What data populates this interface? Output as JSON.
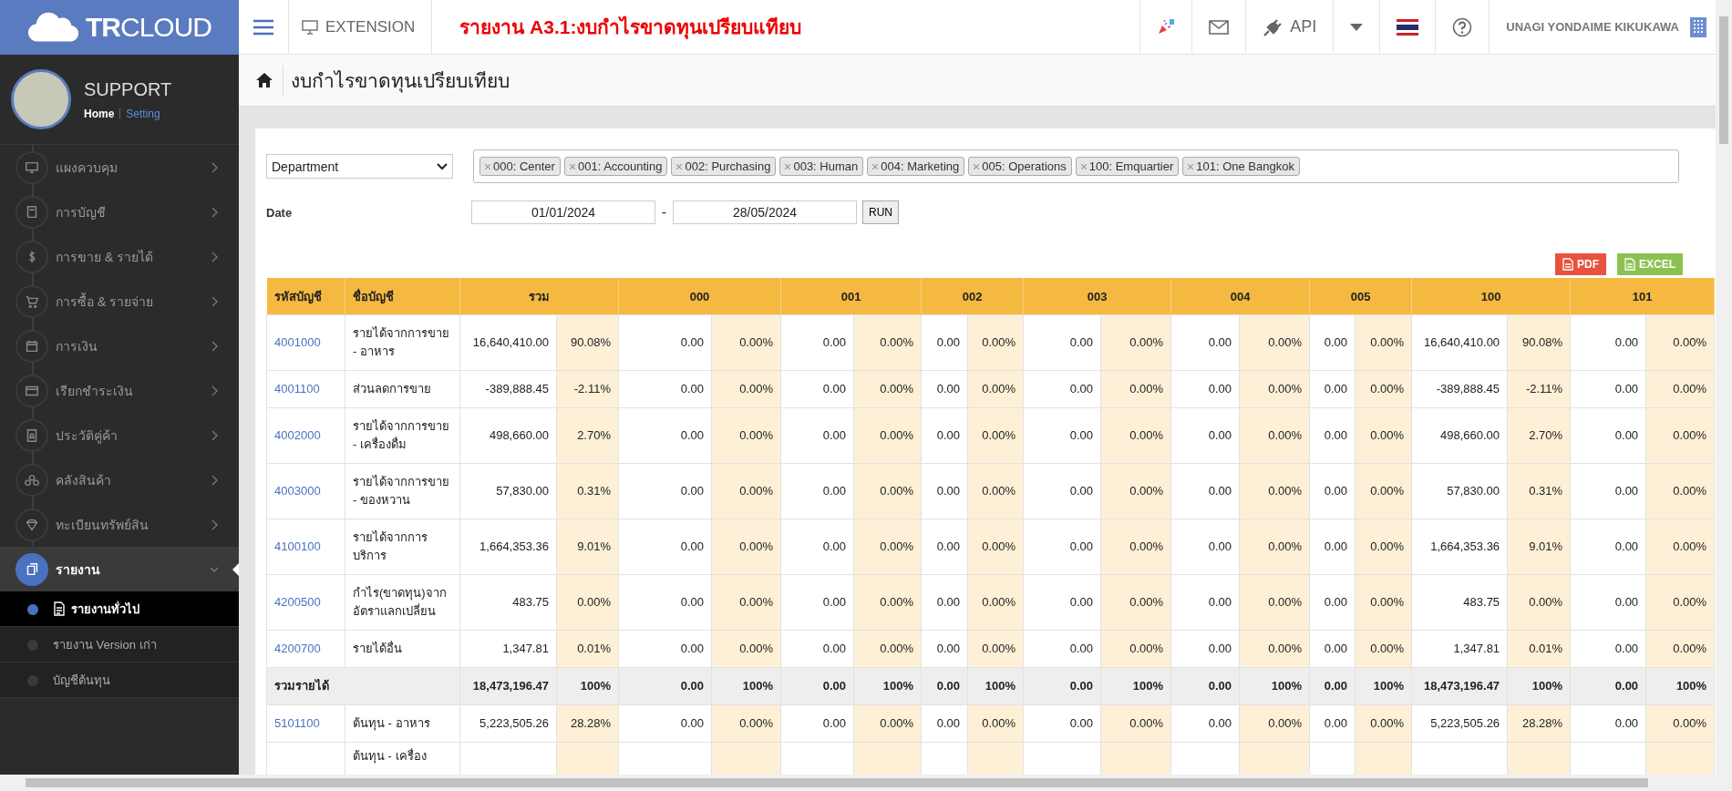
{
  "brand": {
    "bold": "TR",
    "rest": "CLOUD"
  },
  "profile": {
    "name": "SUPPORT",
    "links": [
      {
        "label": "Home",
        "selected": true
      },
      {
        "label": "Setting",
        "selected": false
      }
    ]
  },
  "sidebar": {
    "items": [
      {
        "label": "แผงควบคุม",
        "expanded": false
      },
      {
        "label": "การบัญชี",
        "expanded": false
      },
      {
        "label": "การขาย & รายได้",
        "expanded": false
      },
      {
        "label": "การซื้อ & รายจ่าย",
        "expanded": false
      },
      {
        "label": "การเงิน",
        "expanded": false
      },
      {
        "label": "เรียกชำระเงิน",
        "expanded": false
      },
      {
        "label": "ประวัติคู่ค้า",
        "expanded": false
      },
      {
        "label": "คลังสินค้า",
        "expanded": false
      },
      {
        "label": "ทะเบียนทรัพย์สิน",
        "expanded": false
      },
      {
        "label": "รายงาน",
        "expanded": true,
        "children": [
          {
            "label": "รายงานทั่วไป",
            "selected": true
          },
          {
            "label": "รายงาน Version เก่า",
            "selected": false
          },
          {
            "label": "บัญชีต้นทุน",
            "selected": false
          }
        ]
      }
    ]
  },
  "topbar": {
    "extension": "EXTENSION",
    "report_title": "รายงาน A3.1:งบกำไรขาดทุนเปรียบแทียบ",
    "api": "API",
    "user": "UNAGI YONDAIME KIKUKAWA"
  },
  "breadcrumb": "งบกำไรขาดทุนเปรียบเทียบ",
  "filters": {
    "dimension": "Department",
    "tags": [
      "000: Center",
      "001: Accounting",
      "002: Purchasing",
      "003: Human",
      "004: Marketing",
      "005: Operations",
      "100: Emquartier",
      "101: One Bangkok"
    ],
    "date_label": "Date",
    "date_from": "01/01/2024",
    "separator": "-",
    "date_to": "28/05/2024",
    "run": "RUN"
  },
  "exports": [
    {
      "kind": "pdf",
      "label": "PDF"
    },
    {
      "kind": "excel",
      "label": "EXCEL"
    }
  ],
  "table": {
    "columns": {
      "code": "รหัสบัญชี",
      "name": "ชื่อบัญชี",
      "groups": [
        "รวม",
        "000",
        "001",
        "002",
        "003",
        "004",
        "005",
        "100",
        "101"
      ]
    },
    "rows": [
      {
        "kind": "account",
        "code": "4001000",
        "name": "รายได้จากการขาย - อาหาร",
        "values": [
          [
            "16,640,410.00",
            "90.08%"
          ],
          [
            "0.00",
            "0.00%"
          ],
          [
            "0.00",
            "0.00%"
          ],
          [
            "0.00",
            "0.00%"
          ],
          [
            "0.00",
            "0.00%"
          ],
          [
            "0.00",
            "0.00%"
          ],
          [
            "0.00",
            "0.00%"
          ],
          [
            "16,640,410.00",
            "90.08%"
          ],
          [
            "0.00",
            "0.00%"
          ]
        ]
      },
      {
        "kind": "account",
        "code": "4001100",
        "name": "ส่วนลดการขาย",
        "values": [
          [
            "-389,888.45",
            "-2.11%"
          ],
          [
            "0.00",
            "0.00%"
          ],
          [
            "0.00",
            "0.00%"
          ],
          [
            "0.00",
            "0.00%"
          ],
          [
            "0.00",
            "0.00%"
          ],
          [
            "0.00",
            "0.00%"
          ],
          [
            "0.00",
            "0.00%"
          ],
          [
            "-389,888.45",
            "-2.11%"
          ],
          [
            "0.00",
            "0.00%"
          ]
        ]
      },
      {
        "kind": "account",
        "code": "4002000",
        "name": "รายได้จากการขาย - เครื่องดื่ม",
        "values": [
          [
            "498,660.00",
            "2.70%"
          ],
          [
            "0.00",
            "0.00%"
          ],
          [
            "0.00",
            "0.00%"
          ],
          [
            "0.00",
            "0.00%"
          ],
          [
            "0.00",
            "0.00%"
          ],
          [
            "0.00",
            "0.00%"
          ],
          [
            "0.00",
            "0.00%"
          ],
          [
            "498,660.00",
            "2.70%"
          ],
          [
            "0.00",
            "0.00%"
          ]
        ]
      },
      {
        "kind": "account",
        "code": "4003000",
        "name": "รายได้จากการขาย - ของหวาน",
        "values": [
          [
            "57,830.00",
            "0.31%"
          ],
          [
            "0.00",
            "0.00%"
          ],
          [
            "0.00",
            "0.00%"
          ],
          [
            "0.00",
            "0.00%"
          ],
          [
            "0.00",
            "0.00%"
          ],
          [
            "0.00",
            "0.00%"
          ],
          [
            "0.00",
            "0.00%"
          ],
          [
            "57,830.00",
            "0.31%"
          ],
          [
            "0.00",
            "0.00%"
          ]
        ]
      },
      {
        "kind": "account",
        "code": "4100100",
        "name": "รายได้จากการบริการ",
        "values": [
          [
            "1,664,353.36",
            "9.01%"
          ],
          [
            "0.00",
            "0.00%"
          ],
          [
            "0.00",
            "0.00%"
          ],
          [
            "0.00",
            "0.00%"
          ],
          [
            "0.00",
            "0.00%"
          ],
          [
            "0.00",
            "0.00%"
          ],
          [
            "0.00",
            "0.00%"
          ],
          [
            "1,664,353.36",
            "9.01%"
          ],
          [
            "0.00",
            "0.00%"
          ]
        ]
      },
      {
        "kind": "account",
        "code": "4200500",
        "name": "กำไร(ขาดทุน)จากอัตราแลกเปลี่ยน",
        "values": [
          [
            "483.75",
            "0.00%"
          ],
          [
            "0.00",
            "0.00%"
          ],
          [
            "0.00",
            "0.00%"
          ],
          [
            "0.00",
            "0.00%"
          ],
          [
            "0.00",
            "0.00%"
          ],
          [
            "0.00",
            "0.00%"
          ],
          [
            "0.00",
            "0.00%"
          ],
          [
            "483.75",
            "0.00%"
          ],
          [
            "0.00",
            "0.00%"
          ]
        ]
      },
      {
        "kind": "account",
        "code": "4200700",
        "name": "รายได้อื่น",
        "values": [
          [
            "1,347.81",
            "0.01%"
          ],
          [
            "0.00",
            "0.00%"
          ],
          [
            "0.00",
            "0.00%"
          ],
          [
            "0.00",
            "0.00%"
          ],
          [
            "0.00",
            "0.00%"
          ],
          [
            "0.00",
            "0.00%"
          ],
          [
            "0.00",
            "0.00%"
          ],
          [
            "1,347.81",
            "0.01%"
          ],
          [
            "0.00",
            "0.00%"
          ]
        ]
      },
      {
        "kind": "total",
        "name": "รวมรายได้",
        "values": [
          [
            "18,473,196.47",
            "100%"
          ],
          [
            "0.00",
            "100%"
          ],
          [
            "0.00",
            "100%"
          ],
          [
            "0.00",
            "100%"
          ],
          [
            "0.00",
            "100%"
          ],
          [
            "0.00",
            "100%"
          ],
          [
            "0.00",
            "100%"
          ],
          [
            "18,473,196.47",
            "100%"
          ],
          [
            "0.00",
            "100%"
          ]
        ]
      },
      {
        "kind": "account",
        "code": "5101100",
        "name": "ต้นทุน - อาหาร",
        "values": [
          [
            "5,223,505.26",
            "28.28%"
          ],
          [
            "0.00",
            "0.00%"
          ],
          [
            "0.00",
            "0.00%"
          ],
          [
            "0.00",
            "0.00%"
          ],
          [
            "0.00",
            "0.00%"
          ],
          [
            "0.00",
            "0.00%"
          ],
          [
            "0.00",
            "0.00%"
          ],
          [
            "5,223,505.26",
            "28.28%"
          ],
          [
            "0.00",
            "0.00%"
          ]
        ]
      },
      {
        "kind": "partial",
        "name": "ต้นทุน - เครื่อง"
      }
    ]
  }
}
